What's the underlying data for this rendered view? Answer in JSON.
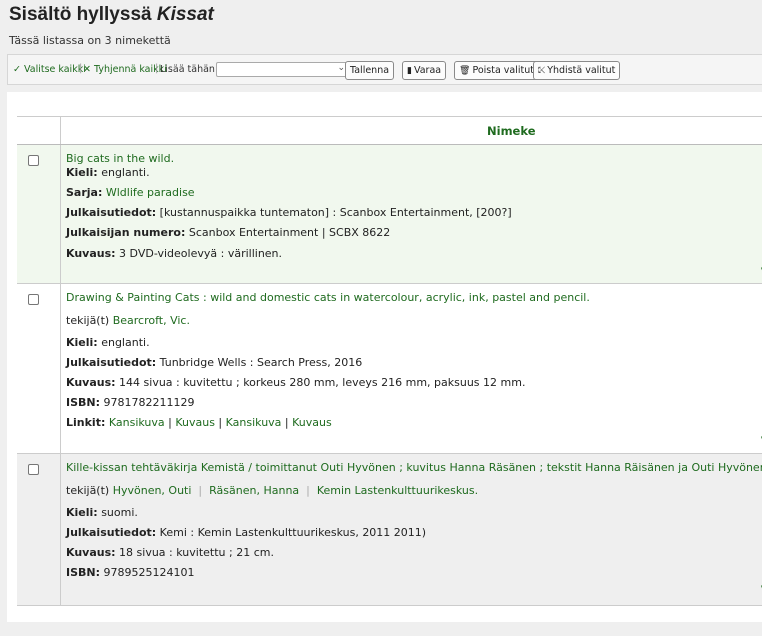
{
  "header": {
    "title_prefix": "Sisältö hyllyssä",
    "title_list": "Kissat",
    "count_text": "Tässä listassa on 3 nimekettä"
  },
  "toolbar": {
    "select_all": "Valitse kaikki",
    "clear_all": "Tyhjennä kaikki",
    "add_to_label": "Lisää tähän:",
    "add_to_value": "",
    "save": "Tallenna",
    "hold": "Varaa",
    "remove": "Poista valitut",
    "merge": "Yhdistä valitut"
  },
  "table": {
    "column_title": "Nimeke",
    "rows": [
      {
        "title": "Big cats in the wild.",
        "language_label": "Kieli:",
        "language": "englanti.",
        "series_label": "Sarja:",
        "series": "Wldlife paradise",
        "publication_label": "Julkaisutiedot:",
        "publication": "[kustannuspaikka tuntematon] : Scanbox Entertainment, [200?]",
        "publisher_number_label": "Julkaisijan numero:",
        "publisher_number": "Scanbox Entertainment | SCBX 8622",
        "description_label": "Kuvaus:",
        "description": "3 DVD-videolevyä : värillinen."
      },
      {
        "title": "Drawing & Painting Cats : wild and domestic cats in watercolour, acrylic, ink, pastel and pencil.",
        "author_prefix": "tekijä(t)",
        "author": "Bearcroft, Vic.",
        "language_label": "Kieli:",
        "language": "englanti.",
        "publication_label": "Julkaisutiedot:",
        "publication": "Tunbridge Wells : Search Press, 2016",
        "description_label": "Kuvaus:",
        "description": "144 sivua : kuvitettu ; korkeus 280 mm, leveys 216 mm, paksuus 12 mm.",
        "isbn_label": "ISBN:",
        "isbn": "9781782211129",
        "links_label": "Linkit:",
        "links": [
          "Kansikuva",
          "Kuvaus",
          "Kansikuva",
          "Kuvaus"
        ]
      },
      {
        "title": "Kille-kissan tehtäväkirja Kemistä / toimittanut Outi Hyvönen ; kuvitus Hanna Räsänen ; tekstit Hanna Räisänen ja Outi Hyvönen.",
        "author_prefix": "tekijä(t)",
        "authors": [
          "Hyvönen, Outi",
          "Räsänen, Hanna",
          "Kemin Lastenkulttuurikeskus."
        ],
        "language_label": "Kieli:",
        "language": "suomi.",
        "publication_label": "Julkaisutiedot:",
        "publication": "Kemi : Kemin Lastenkulttuurikeskus, 2011 2011)",
        "description_label": "Kuvaus:",
        "description": "18 sivua : kuvitettu ; 21 cm.",
        "isbn_label": "ISBN:",
        "isbn": "9789525124101"
      }
    ]
  },
  "colors": {
    "link": "#1f6b1f",
    "row_highlight": "#f1f8ee",
    "row_gray": "#efefef"
  }
}
